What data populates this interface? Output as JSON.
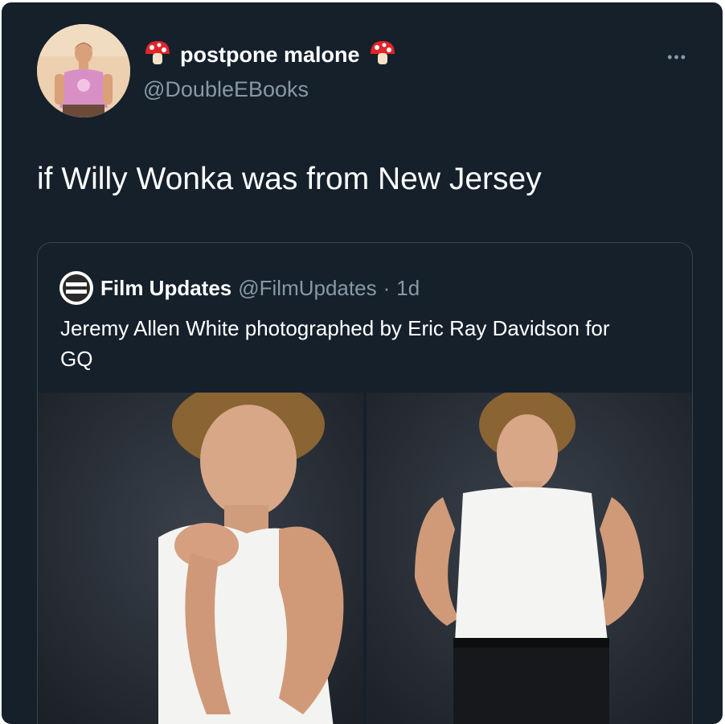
{
  "tweet": {
    "display_name": "postpone malone",
    "handle": "@DoubleEBooks",
    "text": "if Willy Wonka was from New Jersey",
    "more_label": "•••",
    "name_emoji_icon": "mushroom-icon"
  },
  "quoted_tweet": {
    "display_name": "Film Updates",
    "handle": "@FilmUpdates",
    "separator": "·",
    "time": "1d",
    "text": "Jeremy Allen White photographed by Eric Ray Davidson for GQ",
    "logo_icon": "film-updates-logo-icon",
    "photos": [
      {
        "name": "photo-left"
      },
      {
        "name": "photo-right"
      }
    ]
  },
  "colors": {
    "background": "#15202b",
    "text_primary": "#ffffff",
    "text_secondary": "#8899a6",
    "border": "#38444d"
  }
}
